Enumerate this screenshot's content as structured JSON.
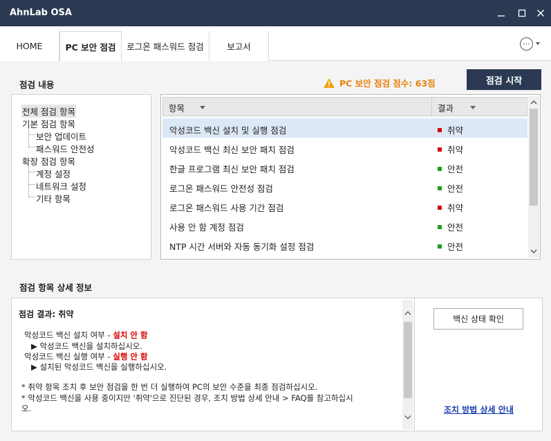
{
  "window": {
    "title": "AhnLab OSA"
  },
  "tabs": [
    {
      "label": "HOME"
    },
    {
      "label": "PC 보안 점검"
    },
    {
      "label": "로그온 패스워드 점검"
    },
    {
      "label": "보고서"
    }
  ],
  "more_menu": {
    "glyph": "···"
  },
  "check": {
    "section_title": "점검 내용",
    "score_text": "PC 보안 점검 점수: 63점",
    "start_button": "점검 시작"
  },
  "tree": {
    "root": "전체 점검 항목",
    "basic": "기본 점검 항목",
    "basic_children": [
      "보안 업데이트",
      "패스워드 안전성"
    ],
    "extended": "확장 점검 항목",
    "extended_children": [
      "계정 설정",
      "네트워크 설정",
      "기타 항목"
    ]
  },
  "grid": {
    "col_item": "항목",
    "col_result": "결과",
    "rows": [
      {
        "name": "악성코드 백신 설치 및 실행 점검",
        "result": "취약",
        "status_color": "#d40000"
      },
      {
        "name": "악성코드 백신 최신 보안 패치 점검",
        "result": "취약",
        "status_color": "#d40000"
      },
      {
        "name": "한글 프로그램 최신 보안 패치 점검",
        "result": "안전",
        "status_color": "#1aa01a"
      },
      {
        "name": "로그온 패스워드 안전성 점검",
        "result": "안전",
        "status_color": "#1aa01a"
      },
      {
        "name": "로그온 패스워드 사용 기간 점검",
        "result": "취약",
        "status_color": "#d40000"
      },
      {
        "name": "사용 안 함 계정 점검",
        "result": "안전",
        "status_color": "#1aa01a"
      },
      {
        "name": "NTP 시간 서버와 자동 동기화 설정 점검",
        "result": "안전",
        "status_color": "#1aa01a"
      }
    ]
  },
  "detail": {
    "section_title": "점검 항목 상세 정보",
    "result_line": "점검 결과: 취약",
    "install_label": "악성코드 백신 설치 여부 - ",
    "install_value": "설치 안 함",
    "install_hint": "▶ 악성코드 백신을 설치하십시오.",
    "run_label": "악성코드 백신 실행 여부 - ",
    "run_value": "실행 안 함",
    "run_hint": "▶ 설치된 악성코드 백신을 실행하십시오.",
    "note1": "* 취약 항목 조치 후 보안 점검을 한 번 더 실행하여 PC의 보안 수준을 최종 점검하십시오.",
    "note2a": "* 악성코드 백신을 사용 중이지만 '취약'으로 진단된 경우, 조치 방법 상세 안내 > FAQ를 참고하십시",
    "note2b": "오."
  },
  "side": {
    "vaccine_button": "백신 상태 확인",
    "guide_link": "조치 방법 상세 안내"
  },
  "colors": {
    "titlebar": "#2b3a52",
    "warning": "#e8810c",
    "critical": "#d80000",
    "link": "#1a3fb0"
  }
}
